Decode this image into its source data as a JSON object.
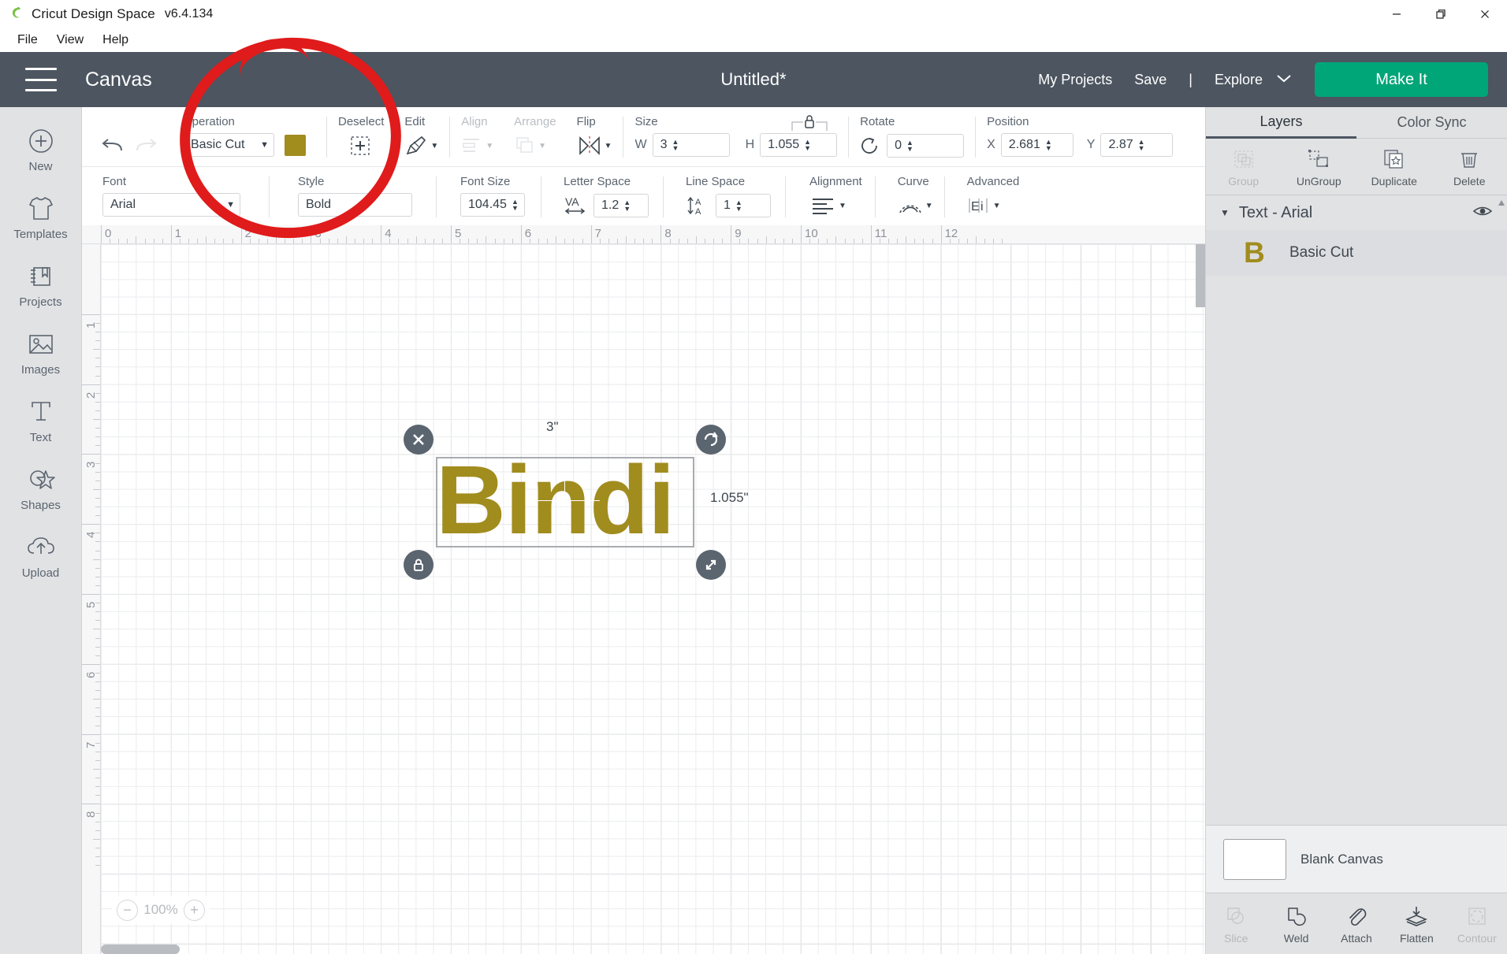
{
  "titlebar": {
    "app_name": "Cricut Design Space",
    "version": "v6.4.134",
    "minimize": "minimize-icon",
    "maximize": "restore-icon",
    "close": "close-icon"
  },
  "menubar": {
    "items": [
      "File",
      "View",
      "Help"
    ]
  },
  "header": {
    "canvas_label": "Canvas",
    "doc_title": "Untitled*",
    "my_projects": "My Projects",
    "save": "Save",
    "separator": "|",
    "explore": "Explore",
    "make_it": "Make It",
    "accent_green": "#00a578",
    "bar_color": "#4c5560"
  },
  "sidebar": {
    "items": [
      {
        "label": "New",
        "icon": "plus-circle-icon"
      },
      {
        "label": "Templates",
        "icon": "tshirt-icon"
      },
      {
        "label": "Projects",
        "icon": "book-bookmark-icon"
      },
      {
        "label": "Images",
        "icon": "picture-icon"
      },
      {
        "label": "Text",
        "icon": "text-t-icon"
      },
      {
        "label": "Shapes",
        "icon": "star-shape-icon"
      },
      {
        "label": "Upload",
        "icon": "cloud-upload-icon"
      }
    ]
  },
  "toolbar_row1": {
    "undo": "undo-icon",
    "redo": "redo-icon",
    "operation_label": "Operation",
    "operation_value": "Basic Cut",
    "operation_color": "#a18c1e",
    "deselect_label": "Deselect",
    "edit_label": "Edit",
    "align_label": "Align",
    "arrange_label": "Arrange",
    "flip_label": "Flip",
    "size_label": "Size",
    "size_w_label": "W",
    "size_w_value": "3",
    "size_h_label": "H",
    "size_h_value": "1.055",
    "size_lock": "lock-icon",
    "rotate_label": "Rotate",
    "rotate_value": "0",
    "position_label": "Position",
    "position_x_label": "X",
    "position_x_value": "2.681",
    "position_y_label": "Y",
    "position_y_value": "2.87"
  },
  "toolbar_row2": {
    "font_label": "Font",
    "font_value": "Arial",
    "style_label": "Style",
    "style_value": "Bold",
    "font_size_label": "Font Size",
    "font_size_value": "104.45",
    "letter_space_label": "Letter Space",
    "letter_space_value": "1.2",
    "line_space_label": "Line Space",
    "line_space_value": "1",
    "alignment_label": "Alignment",
    "curve_label": "Curve",
    "advanced_label": "Advanced"
  },
  "canvas": {
    "ruler_top": [
      "0",
      "1",
      "2",
      "3",
      "4",
      "5",
      "6",
      "7",
      "8",
      "9",
      "10",
      "11",
      "12"
    ],
    "ruler_left": [
      "1",
      "2",
      "3",
      "4",
      "5",
      "6",
      "7",
      "8"
    ],
    "object_text": "Bindi",
    "object_color": "#a18c1e",
    "dim_width": "3\"",
    "dim_height": "1.055\"",
    "handles": {
      "delete": "close-x-icon",
      "rotate": "rotate-icon",
      "lock": "lock-closed-icon",
      "resize": "resize-diagonal-icon"
    },
    "zoom_value": "100%",
    "zoom_out": "minus-icon",
    "zoom_in": "plus-icon"
  },
  "right_panel": {
    "tabs": [
      {
        "label": "Layers",
        "active": true
      },
      {
        "label": "Color Sync",
        "active": false
      }
    ],
    "actions": [
      {
        "label": "Group",
        "icon": "group-icon",
        "disabled": true
      },
      {
        "label": "UnGroup",
        "icon": "ungroup-icon",
        "disabled": false
      },
      {
        "label": "Duplicate",
        "icon": "duplicate-icon",
        "disabled": false
      },
      {
        "label": "Delete",
        "icon": "trash-icon",
        "disabled": false
      }
    ],
    "layer_group": {
      "title": "Text - Arial",
      "caret": "caret-down-icon",
      "visibility": "eye-icon"
    },
    "layer_child": {
      "thumb_letter": "B",
      "thumb_color": "#a18c1e",
      "label": "Basic Cut"
    },
    "canvas_row": {
      "name": "Blank Canvas"
    },
    "bottom_tools": [
      {
        "label": "Slice",
        "icon": "slice-icon",
        "disabled": true
      },
      {
        "label": "Weld",
        "icon": "weld-icon",
        "disabled": false
      },
      {
        "label": "Attach",
        "icon": "paperclip-icon",
        "disabled": false
      },
      {
        "label": "Flatten",
        "icon": "flatten-icon",
        "disabled": false
      },
      {
        "label": "Contour",
        "icon": "contour-icon",
        "disabled": true
      }
    ]
  },
  "annotation": {
    "shape": "red-circle-highlight",
    "color": "#e01b1b"
  }
}
